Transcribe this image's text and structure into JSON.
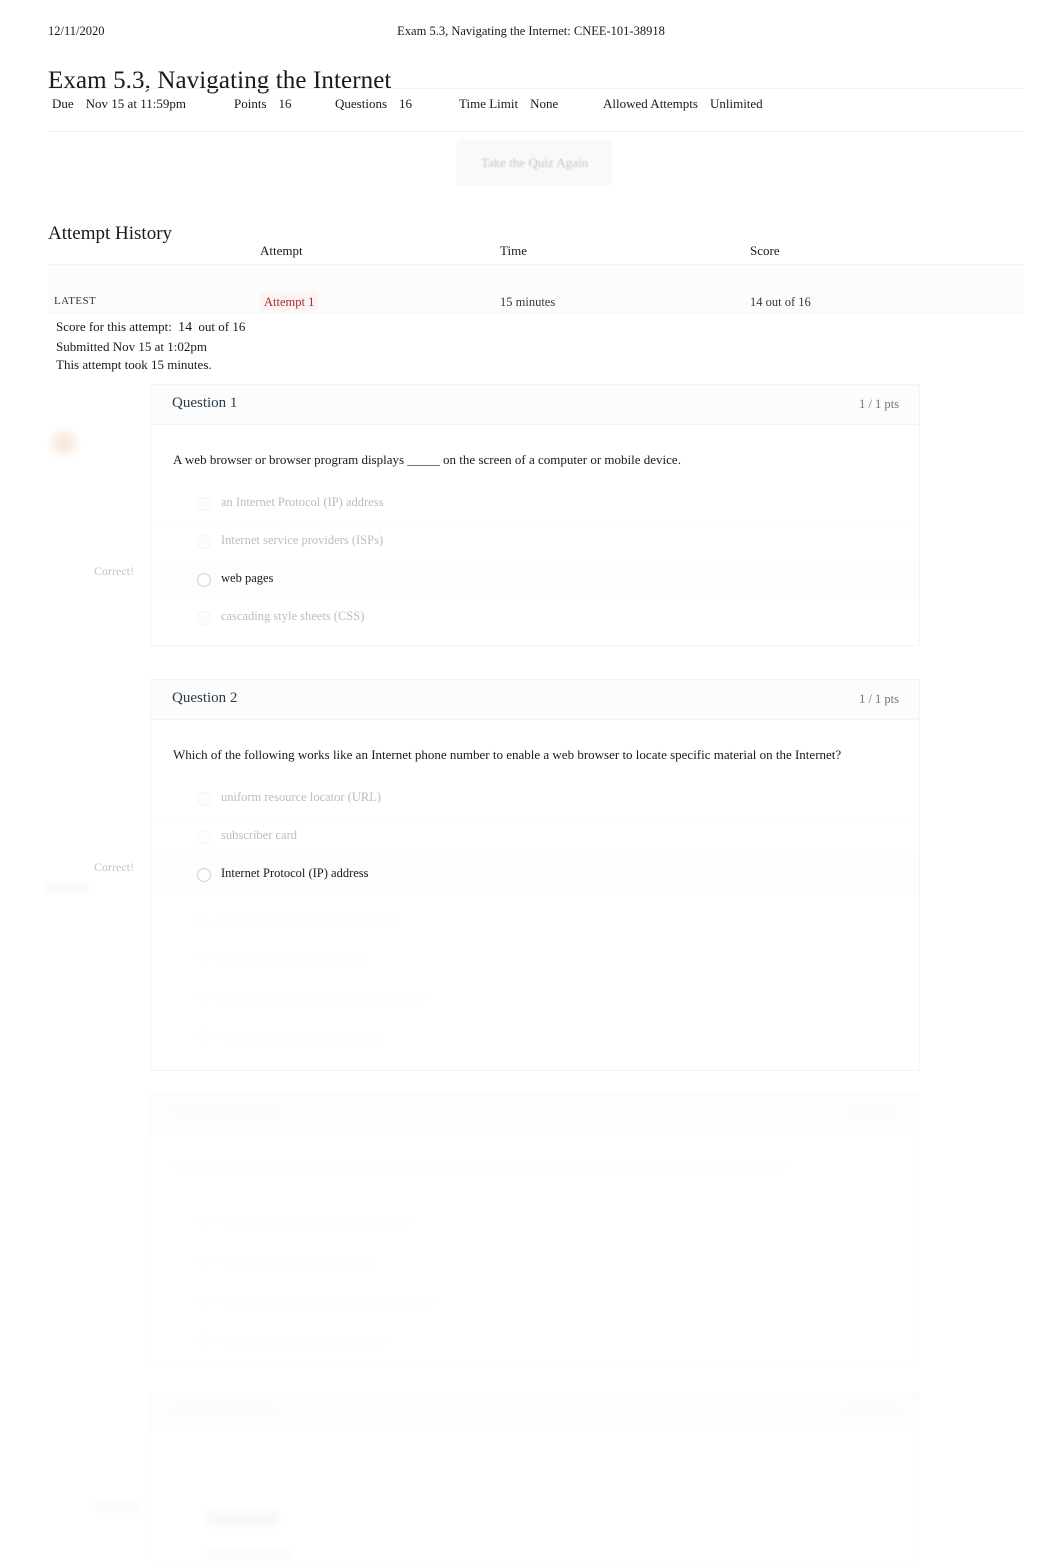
{
  "print_header": {
    "date": "12/11/2020",
    "document_title": "Exam 5.3, Navigating the Internet: CNEE-101-38918"
  },
  "quiz": {
    "title": "Exam 5.3, Navigating the Internet",
    "meta": [
      {
        "key": "Due",
        "value": "Nov 15 at 11:59pm"
      },
      {
        "key": "Points",
        "value": "16"
      },
      {
        "key": "Questions",
        "value": "16"
      },
      {
        "key": "Time Limit",
        "value": "None"
      },
      {
        "key": "Allowed Attempts",
        "value": "Unlimited"
      }
    ],
    "retake_button": "Take the Quiz Again"
  },
  "attempt_history": {
    "heading": "Attempt History",
    "columns": [
      "",
      "Attempt",
      "Time",
      "Score"
    ],
    "rows": [
      {
        "kept": "LATEST",
        "attempt": "Attempt 1",
        "time": "15 minutes",
        "score": "14 out of 16"
      }
    ]
  },
  "score_summary": {
    "score_label": "Score for this attempt:",
    "score_value": "14",
    "score_out_of": "out of 16",
    "submitted": "Submitted Nov 15 at 1:02pm",
    "duration": "This attempt took 15 minutes."
  },
  "questions": [
    {
      "name": "Question 1",
      "points": "1 / 1 pts",
      "marker": "Correct!",
      "text": "A web browser   or browser program displays _____ on the screen of a computer or mobile device.",
      "answers": [
        {
          "label": "an Internet Protocol (IP) address",
          "selected": false
        },
        {
          "label": "Internet service providers (ISPs)",
          "selected": false
        },
        {
          "label": "web pages",
          "selected": true
        },
        {
          "label": "cascading style sheets (CSS)",
          "selected": false
        }
      ]
    },
    {
      "name": "Question 2",
      "points": "1 / 1 pts",
      "marker": "Correct!",
      "text": "Which of the following works like an Internet phone number to enable a web browser to locate specific material on the Internet?",
      "answers": [
        {
          "label": "uniform resource locator (URL)",
          "selected": false
        },
        {
          "label": "subscriber card",
          "selected": false
        },
        {
          "label": "Internet Protocol (IP) address",
          "selected": true
        }
      ]
    }
  ],
  "colors": {
    "text": "#1a1a1a",
    "muted": "#b9bdc1",
    "accent_link": "#ad2b2b",
    "card_border": "#f3f4f5",
    "card_header_bg": "#fcfcfd"
  }
}
